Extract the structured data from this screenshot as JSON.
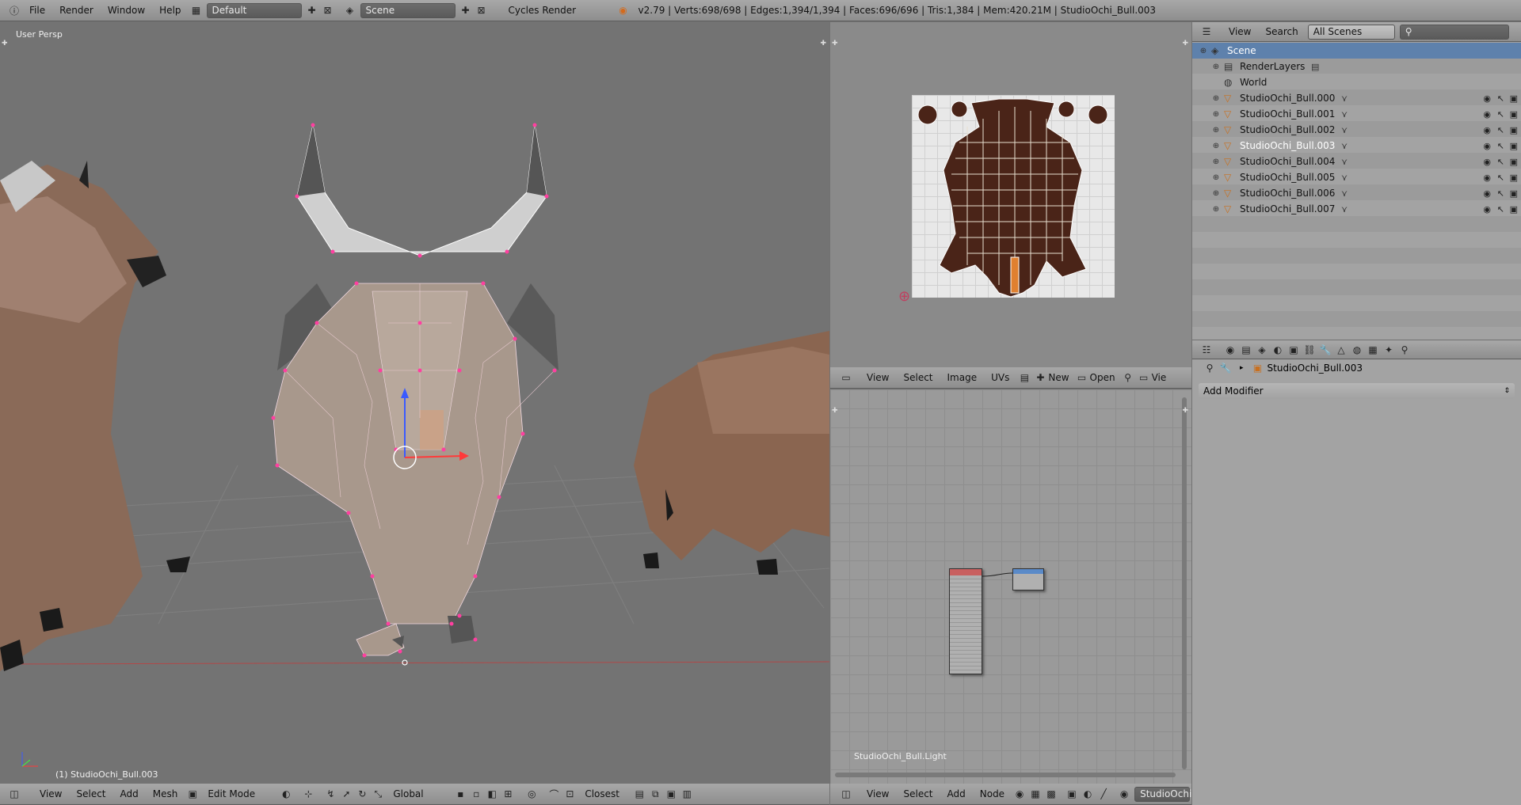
{
  "topbar": {
    "menu": [
      "File",
      "Render",
      "Window",
      "Help"
    ],
    "layout": "Default",
    "scene": "Scene",
    "engine": "Cycles Render",
    "stats": "v2.79 | Verts:698/698 | Edges:1,394/1,394 | Faces:696/696 | Tris:1,384 | Mem:420.21M | StudioOchi_Bull.003"
  },
  "viewport": {
    "view_label": "User Persp",
    "object_label": "(1) StudioOchi_Bull.003",
    "header": {
      "menus": [
        "View",
        "Select",
        "Add",
        "Mesh"
      ],
      "mode": "Edit Mode",
      "orientation": "Global",
      "snap": "Closest"
    }
  },
  "uv_editor": {
    "header": {
      "menus": [
        "View",
        "Select",
        "Image",
        "UVs"
      ],
      "new_label": "New",
      "open_label": "Open",
      "view_cut": "Vie"
    }
  },
  "node_editor": {
    "material_label": "StudioOchi_Bull.Light",
    "header": {
      "menus": [
        "View",
        "Select",
        "Add",
        "Node"
      ],
      "object": "StudioOchi"
    }
  },
  "outliner": {
    "header": {
      "view": "View",
      "search": "Search",
      "filter": "All Scenes"
    },
    "items": [
      {
        "label": "Scene",
        "type": "scene",
        "indent": 0,
        "selected": true
      },
      {
        "label": "RenderLayers",
        "type": "renderlayers",
        "indent": 1
      },
      {
        "label": "World",
        "type": "world",
        "indent": 1
      },
      {
        "label": "StudioOchi_Bull.000",
        "type": "mesh",
        "indent": 1
      },
      {
        "label": "StudioOchi_Bull.001",
        "type": "mesh",
        "indent": 1
      },
      {
        "label": "StudioOchi_Bull.002",
        "type": "mesh",
        "indent": 1
      },
      {
        "label": "StudioOchi_Bull.003",
        "type": "mesh",
        "indent": 1,
        "active": true
      },
      {
        "label": "StudioOchi_Bull.004",
        "type": "mesh",
        "indent": 1
      },
      {
        "label": "StudioOchi_Bull.005",
        "type": "mesh",
        "indent": 1
      },
      {
        "label": "StudioOchi_Bull.006",
        "type": "mesh",
        "indent": 1
      },
      {
        "label": "StudioOchi_Bull.007",
        "type": "mesh",
        "indent": 1
      }
    ]
  },
  "properties": {
    "object": "StudioOchi_Bull.003",
    "add_modifier": "Add Modifier"
  },
  "colors": {
    "accent": "#5e81ac",
    "vertex": "#ff3fa0",
    "active_text": "#ffffff"
  }
}
